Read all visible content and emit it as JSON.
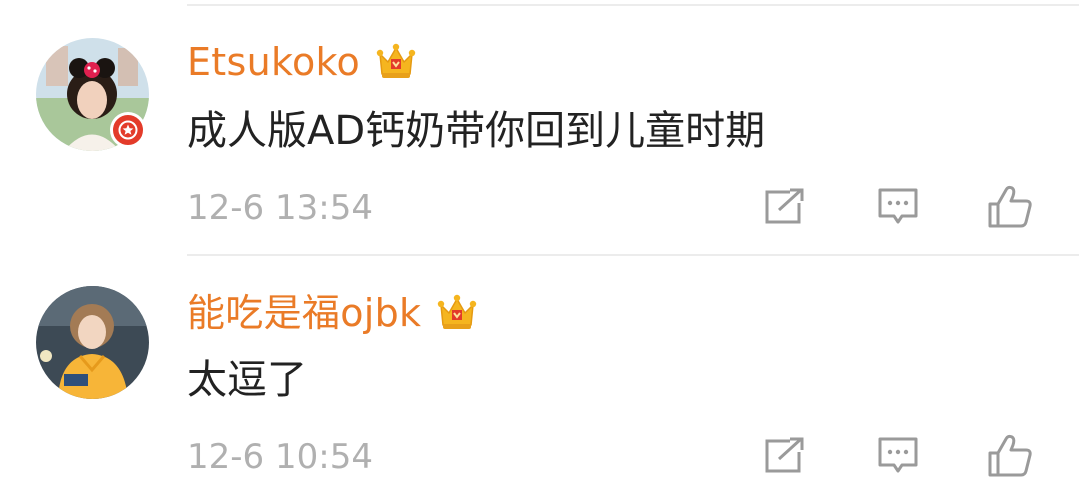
{
  "comments": [
    {
      "username": "Etsukoko",
      "text": "成人版AD钙奶带你回到儿童时期",
      "timestamp": "12-6 13:54",
      "has_vip_crown": true,
      "has_verified_badge": true
    },
    {
      "username": "能吃是福ojbk",
      "text": "太逗了",
      "timestamp": "12-6 10:54",
      "has_vip_crown": true,
      "has_verified_badge": false
    }
  ],
  "actions": {
    "repost_icon": "share-box-icon",
    "reply_icon": "comment-bubble-icon",
    "like_icon": "thumbs-up-icon"
  },
  "colors": {
    "username": "#ea7b27",
    "text": "#222222",
    "timestamp": "#b0b0b0",
    "icon": "#9a9a9a",
    "divider": "#ececec",
    "crown": "#f5b51f",
    "badge": "#e33b2a"
  }
}
